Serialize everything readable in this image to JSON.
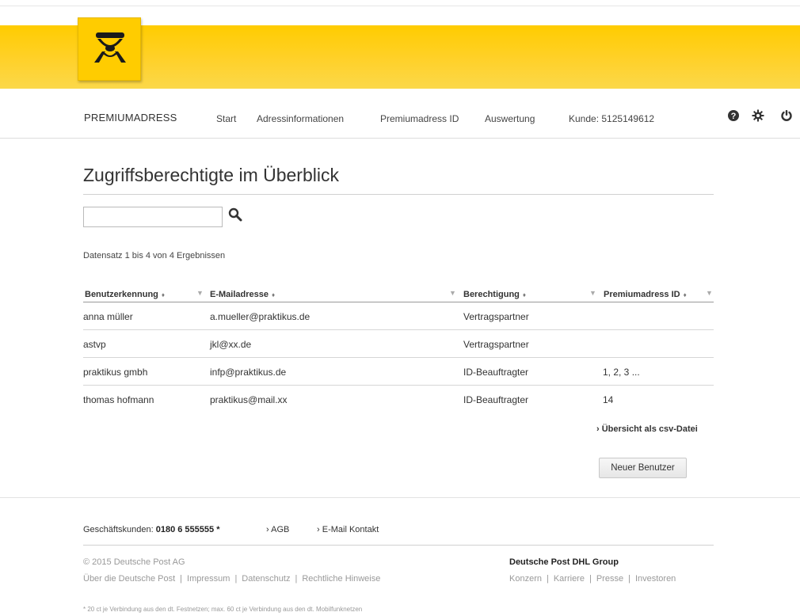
{
  "colors": {
    "brand_yellow": "#ffcc00",
    "text": "#333333"
  },
  "logo": {
    "icon": "posthorn-icon"
  },
  "nav": {
    "brand": "PREMIUMADRESS",
    "links": [
      "Start",
      "Adressinformationen",
      "Premiumadress ID",
      "Auswertung",
      "Kunde: 5125149612"
    ],
    "icons": [
      "help-icon",
      "settings-icon",
      "power-icon"
    ]
  },
  "page": {
    "title": "Zugriffsberechtigte im Überblick",
    "search_value": "",
    "result_info": "Datensatz 1 bis 4 von 4 Ergebnissen"
  },
  "table": {
    "headers": [
      "Benutzerkennung",
      "E-Mailadresse",
      "Berechtigung",
      "Premiumadress ID"
    ],
    "rows": [
      [
        "anna müller",
        "a.mueller@praktikus.de",
        "Vertragspartner",
        ""
      ],
      [
        "astvp",
        "jkl@xx.de",
        "Vertragspartner",
        ""
      ],
      [
        "praktikus gmbh",
        "infp@praktikus.de",
        "ID-Beauftragter",
        "1, 2, 3 ..."
      ],
      [
        "thomas hofmann",
        "praktikus@mail.xx",
        "ID-Beauftragter",
        "14"
      ]
    ]
  },
  "actions": {
    "csv_link": "Übersicht als csv-Datei",
    "new_user": "Neuer Benutzer"
  },
  "footer": {
    "contact_label": "Geschäftskunden:",
    "contact_phone": "0180 6 555555 *",
    "links": [
      "AGB",
      "E-Mail Kontakt"
    ],
    "copyright": "© 2015 Deutsche Post AG",
    "left_links": [
      "Über die Deutsche Post",
      "Impressum",
      "Datenschutz",
      "Rechtliche Hinweise"
    ],
    "group_title": "Deutsche Post DHL Group",
    "right_links": [
      "Konzern",
      "Karriere",
      "Presse",
      "Investoren"
    ],
    "disclaimer": "* 20 ct je Verbindung aus den dt. Festnetzen; max. 60 ct je Verbindung aus den dt. Mobilfunknetzen"
  }
}
